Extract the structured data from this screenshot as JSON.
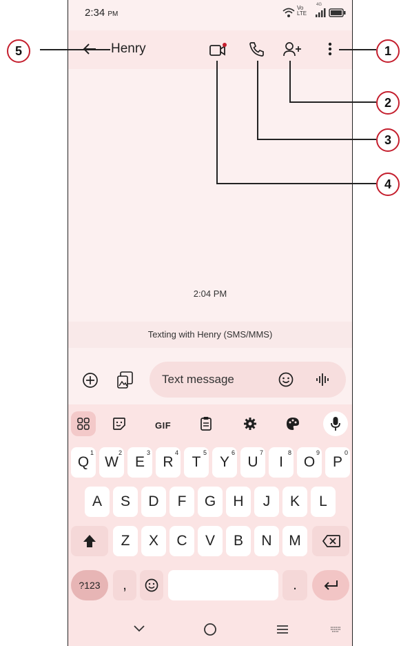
{
  "status_bar": {
    "time": "2:34",
    "ampm": "PM",
    "network": "Vo LTE",
    "network_gen": "4G"
  },
  "app_bar": {
    "contact_name": "Henry"
  },
  "conversation": {
    "timestamp": "2:04 PM",
    "info": "Texting with Henry (SMS/MMS)"
  },
  "composer": {
    "placeholder": "Text message"
  },
  "keyboard": {
    "toolbar_gif": "GIF",
    "row1": [
      {
        "k": "Q",
        "n": "1"
      },
      {
        "k": "W",
        "n": "2"
      },
      {
        "k": "E",
        "n": "3"
      },
      {
        "k": "R",
        "n": "4"
      },
      {
        "k": "T",
        "n": "5"
      },
      {
        "k": "Y",
        "n": "6"
      },
      {
        "k": "U",
        "n": "7"
      },
      {
        "k": "I",
        "n": "8"
      },
      {
        "k": "O",
        "n": "9"
      },
      {
        "k": "P",
        "n": "0"
      }
    ],
    "row2": [
      "A",
      "S",
      "D",
      "F",
      "G",
      "H",
      "J",
      "K",
      "L"
    ],
    "row3": [
      "Z",
      "X",
      "C",
      "V",
      "B",
      "N",
      "M"
    ],
    "symbols_key": "?123",
    "comma_key": ",",
    "period_key": "."
  },
  "callouts": {
    "c1": "1",
    "c2": "2",
    "c3": "3",
    "c4": "4",
    "c5": "5"
  },
  "colors": {
    "accent_red": "#c41e2d",
    "background": "#fcf0f0",
    "keyboard_bg": "#fbe4e4"
  },
  "icons": [
    "back-arrow-icon",
    "video-call-icon",
    "phone-call-icon",
    "add-person-icon",
    "more-vert-icon",
    "add-circle-icon",
    "gallery-icon",
    "emoji-icon",
    "voice-wave-icon",
    "apps-grid-icon",
    "sticker-icon",
    "clipboard-icon",
    "settings-icon",
    "palette-icon",
    "mic-icon",
    "shift-icon",
    "backspace-icon",
    "enter-icon",
    "nav-back-icon",
    "nav-home-icon",
    "nav-recents-icon",
    "keyboard-switch-icon"
  ]
}
